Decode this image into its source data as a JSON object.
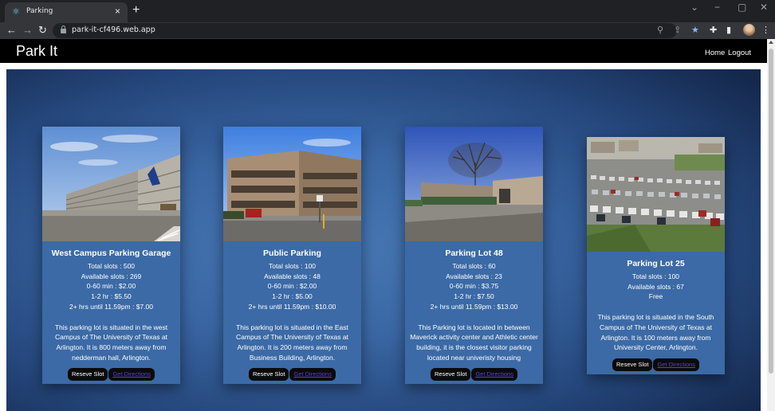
{
  "browser": {
    "tab_title": "Parking",
    "tab_close": "×",
    "new_tab": "+",
    "url": "park-it-cf496.web.app",
    "accent_star_color": "#8ab4f8"
  },
  "header": {
    "brand": "Park It",
    "nav": [
      "Home",
      "Logout"
    ]
  },
  "cards": [
    {
      "title": "West Campus Parking Garage",
      "info": [
        "Total slots : 500",
        "Available slots : 269",
        "0-60 min : $2.00",
        "1-2 hr : $5.50",
        "2+ hrs until 11.59pm : $7.00"
      ],
      "description": "This parking lot is situated in the west Campus of The University of Texas at Arlington. It is 800 meters away from nedderman hall, Arlington.",
      "reserve_label": "Reseve Slot",
      "directions_label": "Get Directions"
    },
    {
      "title": "Public Parking",
      "info": [
        "Total slots : 100",
        "Available slots : 48",
        "0-60 min : $2.00",
        "1-2 hr : $5.00",
        "2+ hrs until 11.59pm : $10.00"
      ],
      "description": "This parking lot is situated in the East Campus of The University of Texas at Arlington. It is 200 meters away from Business Building, Arlington.",
      "reserve_label": "Reseve Slot",
      "directions_label": "Get Directions"
    },
    {
      "title": "Parking Lot 48",
      "info": [
        "Total slots : 60",
        "Available slots : 23",
        "0-60 min : $3.75",
        "1-2 hr : $7.50",
        "2+ hrs until 11.59pm : $13.00"
      ],
      "description": "This Parking lot is located in between Maverick activity center and Athletic center building, it is the closest visitor parking located near univeristy housing",
      "reserve_label": "Reseve Slot",
      "directions_label": "Get Directions"
    },
    {
      "title": "Parking Lot 25",
      "info": [
        "Total slots : 100",
        "Available slots : 67",
        "Free"
      ],
      "description": "This parking lot is situated in the South Campus of The University of Texas at Arlington. It is 100 meters away from University Center, Arlington.",
      "reserve_label": "Reseve Slot",
      "directions_label": "Get Directions"
    }
  ]
}
